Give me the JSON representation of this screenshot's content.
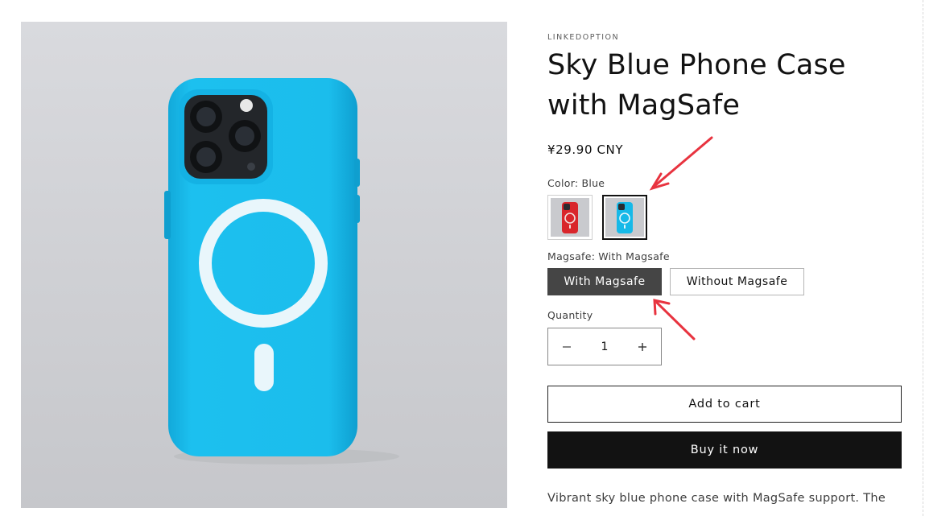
{
  "product": {
    "vendor": "LINKEDOPTION",
    "title": "Sky Blue Phone Case with MagSafe",
    "price": "¥29.90 CNY",
    "description": "Vibrant sky blue phone case with MagSafe support. The"
  },
  "color_option": {
    "label": "Color:",
    "selected": "Blue",
    "swatches": [
      {
        "name": "Red",
        "color": "#d9252b",
        "selected": false
      },
      {
        "name": "Blue",
        "color": "#16b9e8",
        "selected": true
      }
    ]
  },
  "magsafe_option": {
    "label": "Magsafe:",
    "selected": "With Magsafe",
    "choices": [
      "With Magsafe",
      "Without Magsafe"
    ]
  },
  "quantity": {
    "label": "Quantity",
    "value": "1",
    "decrease_icon": "minus-icon",
    "increase_icon": "plus-icon"
  },
  "actions": {
    "add_to_cart": "Add to cart",
    "buy_now": "Buy it now"
  },
  "colors": {
    "case_blue": "#16b9e8",
    "annotation_red": "#e8333f",
    "buy_button": "#121212",
    "active_pill": "#454545"
  }
}
